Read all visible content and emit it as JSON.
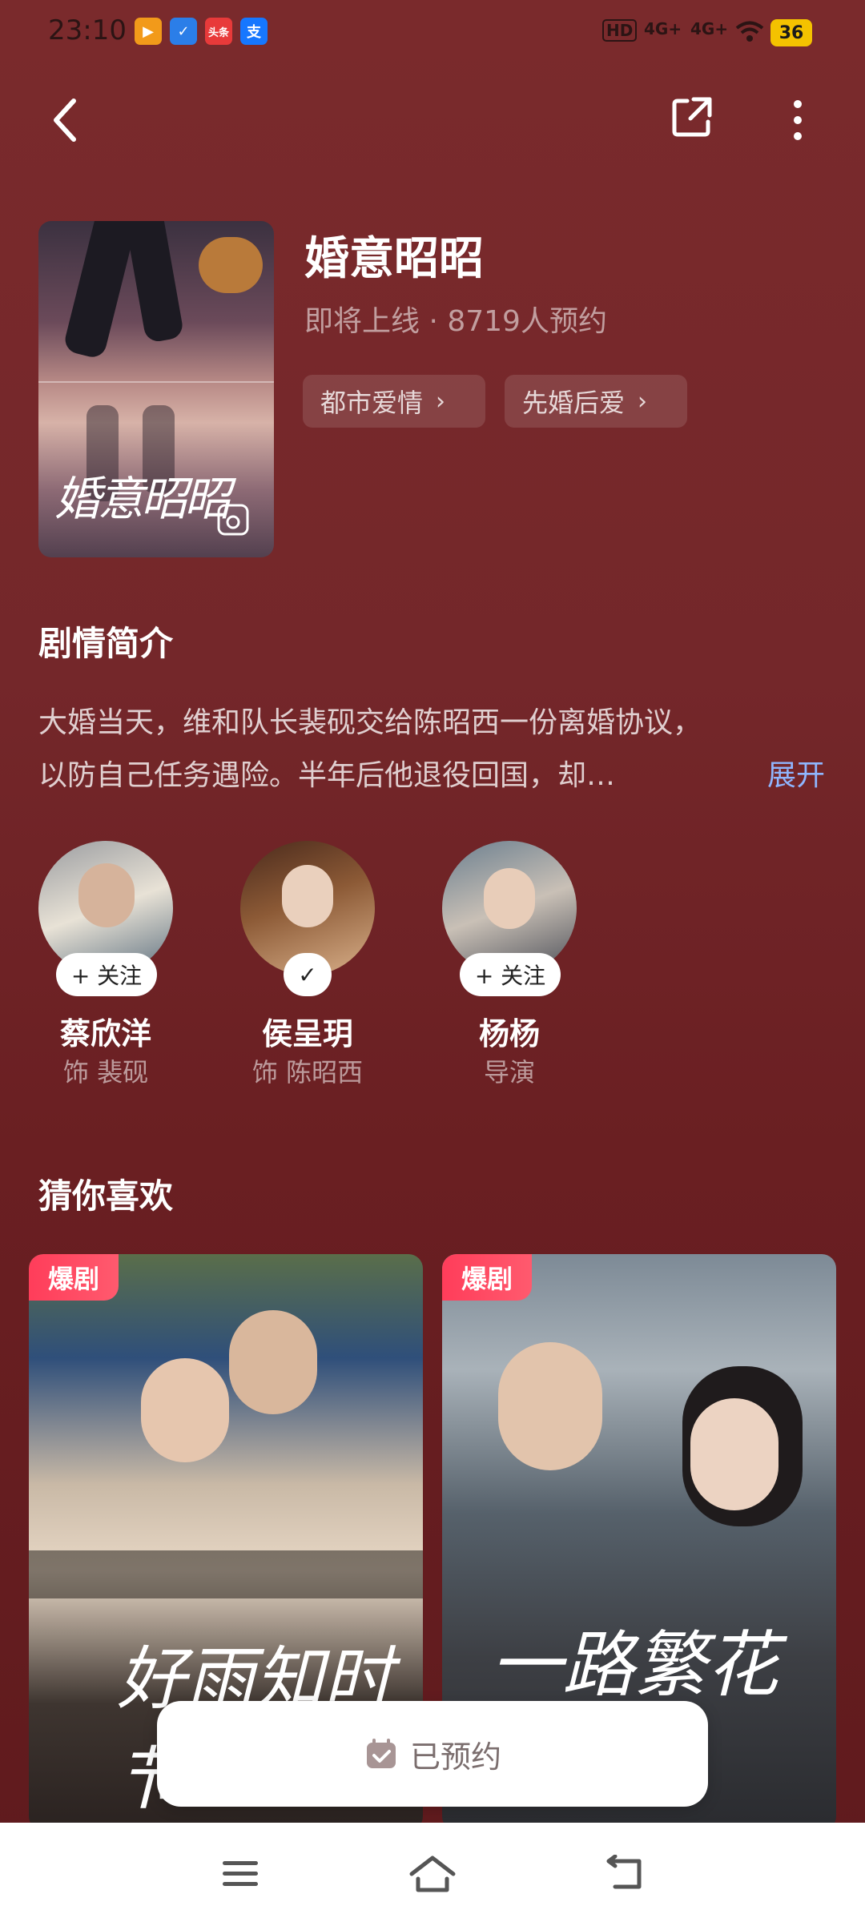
{
  "status_bar": {
    "time": "23:10",
    "apps": [
      {
        "label": "▶",
        "color": "#f29a1a"
      },
      {
        "label": "✓",
        "color": "#2b7ee8"
      },
      {
        "label": "头条",
        "color": "#e83a3a"
      },
      {
        "label": "支",
        "color": "#1677ff"
      }
    ],
    "indicators": [
      "HD",
      "4G+",
      "4G+"
    ],
    "battery": "36"
  },
  "drama": {
    "title": "婚意昭昭",
    "subtitle": "即将上线 · 8719人预约",
    "poster_text": "婚意昭昭",
    "tags": [
      "都市爱情",
      "先婚后爱"
    ]
  },
  "synopsis": {
    "heading": "剧情简介",
    "line1": "大婚当天，维和队长裴砚交给陈昭西一份离婚协议，",
    "line2": "以防自己任务遇险。半年后他退役回国，却…",
    "expand": "展开"
  },
  "cast": [
    {
      "name": "蔡欣洋",
      "role": "饰 裴砚",
      "follow": "+ 关注",
      "followed": false
    },
    {
      "name": "侯呈玥",
      "role": "饰 陈昭西",
      "follow": "✓",
      "followed": true
    },
    {
      "name": "杨杨",
      "role": "导演",
      "follow": "+ 关注",
      "followed": false
    }
  ],
  "recommend": {
    "heading": "猜你喜欢",
    "cards": [
      {
        "badge": "爆剧",
        "poster_text": "好雨知时节"
      },
      {
        "badge": "爆剧",
        "poster_text": "一路繁花"
      }
    ]
  },
  "reserve_button": {
    "label": "已预约"
  }
}
